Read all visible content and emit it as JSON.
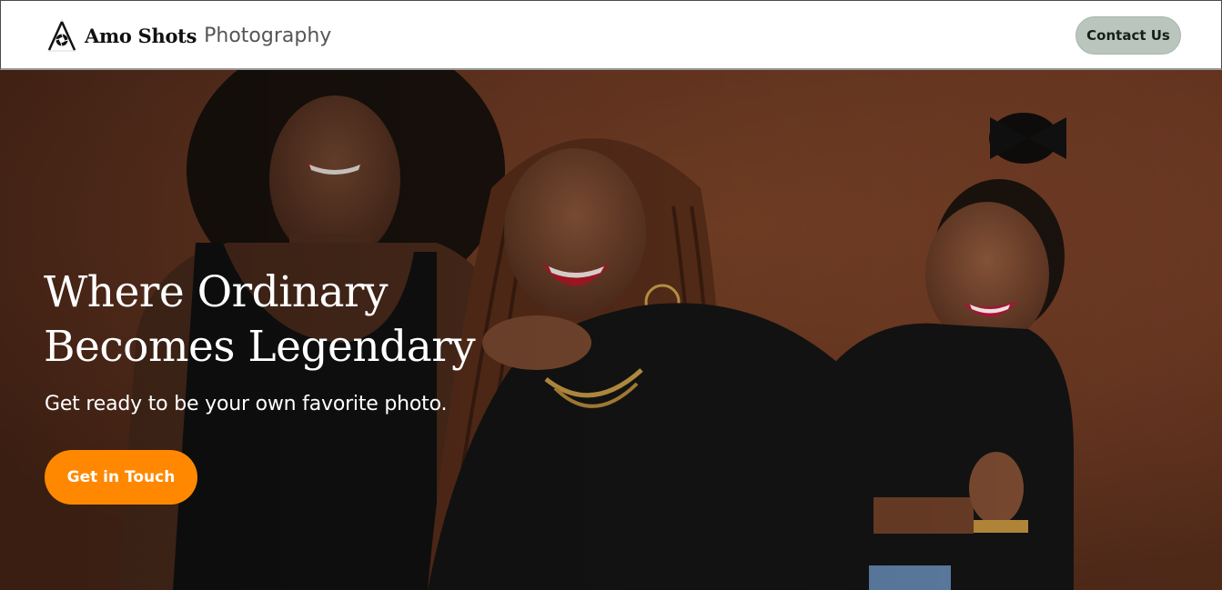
{
  "header": {
    "brand_bold": "Amo Shots",
    "brand_light": "Photography",
    "contact_button": "Contact Us",
    "logo_icon": "aperture-logo-icon"
  },
  "hero": {
    "title_line1": "Where Ordinary",
    "title_line2": "Becomes Legendary",
    "subtitle": "Get ready to be your own favorite photo.",
    "cta_button": "Get in Touch",
    "image_subject": "family-portrait-photo"
  },
  "colors": {
    "contact_button_bg": "#b9c5bd",
    "cta_button_bg": "#ff8800",
    "hero_backdrop": "#6b3a22"
  }
}
